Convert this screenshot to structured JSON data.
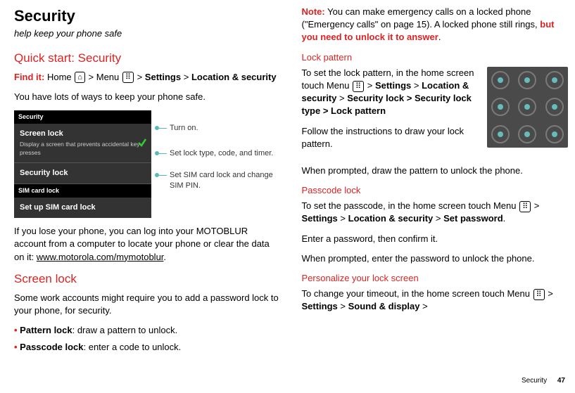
{
  "left": {
    "title": "Security",
    "subtitle": "help keep your phone safe",
    "quickstart_h": "Quick start: Security",
    "findit_label": "Find it:",
    "findit_home": " Home ",
    "findit_menu": " Menu ",
    "findit_settings": "Settings",
    "findit_loc": "Location & security",
    "gt": ">",
    "intro": "You have lots of ways to keep your phone safe.",
    "phone": {
      "header": "Security",
      "row1_title": "Screen lock",
      "row1_sub": "Display a screen that prevents accidental key presses",
      "row2_title": "Security lock",
      "header2": "SIM card lock",
      "row3_title": "Set up SIM card lock"
    },
    "anno1": "Turn on.",
    "anno2": "Set lock type, code, and timer.",
    "anno3": "Set SIM card lock and change SIM PIN.",
    "lose_text1": "If you lose your phone, you can log into your MOTOBLUR account from a computer to locate your phone or clear the data on it: ",
    "lose_link": "www.motorola.com/mymotoblur",
    "screenlock_h": "Screen lock",
    "screenlock_text": "Some work accounts might require you to add a password lock to your phone, for security.",
    "b1_label": "Pattern lock",
    "b1_text": ": draw a pattern to unlock.",
    "b2_label": "Passcode lock",
    "b2_text": ": enter a code to unlock."
  },
  "right": {
    "note_label": "Note:",
    "note_text1": " You can make emergency calls on a locked phone (\"Emergency calls\" on page 15). A locked phone still rings, ",
    "note_red": "but you need to unlock it to answer",
    "lockpat_h": "Lock pattern",
    "lockpat_intro1": "To set the lock pattern, in the home screen touch Menu ",
    "lockpat_gt": ">",
    "lockpat_settings": "Settings",
    "lockpat_loc": "Location & security",
    "lockpat_chain": "Security lock > Security lock type > Lock pattern",
    "lockpat_follow": "Follow the instructions to draw your lock pattern.",
    "lockpat_prompt": "When prompted, draw the pattern to unlock the phone.",
    "passcode_h": "Passcode lock",
    "passcode_intro": "To set the passcode, in the home screen touch Menu ",
    "passcode_settings": "Settings",
    "passcode_loc": "Location & security",
    "passcode_set": "Set password",
    "passcode_enter": "Enter a password, then confirm it.",
    "passcode_prompt": "When prompted, enter the password to unlock the phone.",
    "personalize_h": "Personalize your lock screen",
    "personalize_intro": "To change your timeout, in the home screen touch Menu ",
    "personalize_settings": "Settings",
    "personalize_sound": "Sound & display"
  },
  "footer": {
    "section": "Security",
    "page": "47"
  },
  "icons": {
    "home": "⌂",
    "menu": "⠿"
  }
}
